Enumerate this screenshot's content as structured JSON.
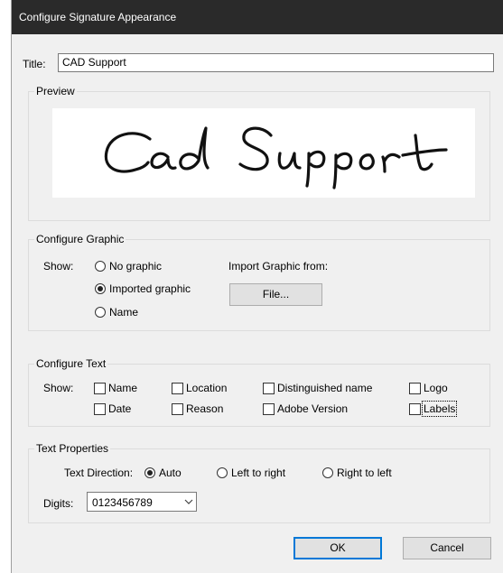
{
  "window": {
    "title": "Configure Signature Appearance"
  },
  "title_field": {
    "label": "Title:",
    "value": "CAD Support"
  },
  "preview": {
    "label": "Preview",
    "signature_text": "Cad Support"
  },
  "configure_graphic": {
    "label": "Configure Graphic",
    "show_label": "Show:",
    "options": [
      {
        "label": "No graphic",
        "selected": false
      },
      {
        "label": "Imported graphic",
        "selected": true
      },
      {
        "label": "Name",
        "selected": false
      }
    ],
    "import_label": "Import Graphic from:",
    "file_button": "File..."
  },
  "configure_text": {
    "label": "Configure Text",
    "show_label": "Show:",
    "checkboxes": [
      {
        "label": "Name",
        "checked": false
      },
      {
        "label": "Location",
        "checked": false
      },
      {
        "label": "Distinguished name",
        "checked": false
      },
      {
        "label": "Logo",
        "checked": false
      },
      {
        "label": "Date",
        "checked": false
      },
      {
        "label": "Reason",
        "checked": false
      },
      {
        "label": "Adobe Version",
        "checked": false
      },
      {
        "label": "Labels",
        "checked": false
      }
    ]
  },
  "text_properties": {
    "label": "Text Properties",
    "direction_label": "Text Direction:",
    "directions": [
      {
        "label": "Auto",
        "selected": true
      },
      {
        "label": "Left to right",
        "selected": false
      },
      {
        "label": "Right to left",
        "selected": false
      }
    ],
    "digits_label": "Digits:",
    "digits_value": "0123456789"
  },
  "buttons": {
    "ok": "OK",
    "cancel": "Cancel"
  },
  "colors": {
    "titlebar": "#2a2a2a",
    "dialog_bg": "#f0f0f0",
    "default_button_border": "#0078d7"
  }
}
